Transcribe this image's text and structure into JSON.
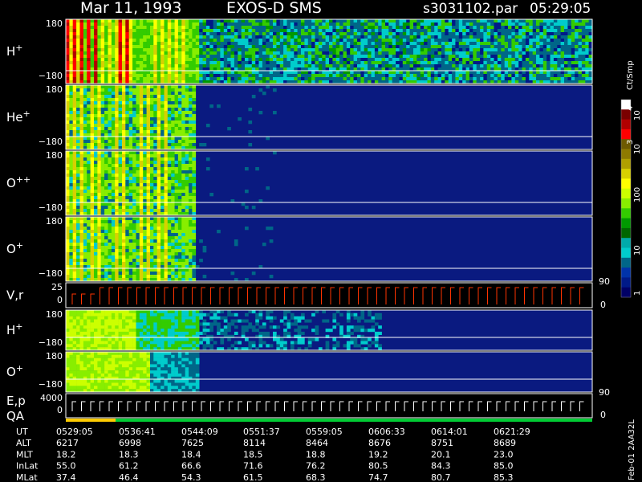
{
  "header": {
    "date": "Mar 11, 1993",
    "instrument": "EXOS-D SMS",
    "file": "s3031102.par",
    "time": "05:29:05"
  },
  "chart_data": {
    "type": "heatmap",
    "panels": [
      {
        "id": "h-plus-1",
        "label": "H",
        "sup": "+",
        "ytop": "180",
        "ybottom": "−180",
        "profile": "h1"
      },
      {
        "id": "he-plus",
        "label": "He",
        "sup": "+",
        "ytop": "180",
        "ybottom": "−180",
        "profile": "dense"
      },
      {
        "id": "o-plus-plus",
        "label": "O",
        "sup": "++",
        "ytop": "180",
        "ybottom": "−180",
        "profile": "dense"
      },
      {
        "id": "o-plus-1",
        "label": "O",
        "sup": "+",
        "ytop": "180",
        "ybottom": "−180",
        "profile": "dense"
      },
      {
        "id": "v-r",
        "label": "V,r",
        "sup": "",
        "ytop": "25",
        "ybottom": "0",
        "right": "90",
        "right_bottom": "0",
        "profile": "line"
      },
      {
        "id": "h-plus-2",
        "label": "H",
        "sup": "+",
        "ytop": "180",
        "ybottom": "−180",
        "profile": "h2"
      },
      {
        "id": "o-plus-2",
        "label": "O",
        "sup": "+",
        "ytop": "180",
        "ybottom": "−180",
        "profile": "o2"
      },
      {
        "id": "e-p-qa",
        "label": "E,p",
        "label2": "QA",
        "sup": "",
        "ytop": "4000",
        "ybottom": "0",
        "right": "90",
        "right_bottom": "0",
        "profile": "steps"
      }
    ],
    "colorbar": {
      "unit": "Ct/Smp",
      "tick_labels": [
        "10",
        "4",
        "10",
        "3",
        "100",
        "10",
        "1"
      ],
      "colors": [
        "#ffffff",
        "#7a0000",
        "#b20000",
        "#ff0000",
        "#6e5a00",
        "#8e7a00",
        "#b0a000",
        "#d8d000",
        "#ffff00",
        "#ccff00",
        "#88ee00",
        "#33cc00",
        "#009900",
        "#006600",
        "#00aaaa",
        "#00cccc",
        "#006688",
        "#0033aa",
        "#001a88",
        "#000066"
      ]
    },
    "time_axis": {
      "rows": [
        {
          "label": "UT",
          "values": [
            "0529:05",
            "0536:41",
            "0544:09",
            "0551:37",
            "0559:05",
            "0606:33",
            "0614:01",
            "0621:29"
          ]
        },
        {
          "label": "ALT",
          "values": [
            "6217",
            "6998",
            "7625",
            "8114",
            "8464",
            "8676",
            "8751",
            "8689"
          ]
        },
        {
          "label": "MLT",
          "values": [
            "18.2",
            "18.3",
            "18.4",
            "18.5",
            "18.8",
            "19.2",
            "20.1",
            "23.0"
          ]
        },
        {
          "label": "InLat",
          "values": [
            "55.0",
            "61.2",
            "66.6",
            "71.6",
            "76.2",
            "80.5",
            "84.3",
            "85.0"
          ]
        },
        {
          "label": "MLat",
          "values": [
            "37.4",
            "46.4",
            "54.3",
            "61.5",
            "68.3",
            "74.7",
            "80.7",
            "85.3"
          ]
        }
      ]
    },
    "footer_id": "Feb-01 2AA32L",
    "colors": {
      "background": "#000000",
      "field": "#0a1a80",
      "quality_bar": "#ffcc00",
      "quality_good": "#00cc33",
      "line_trace": "#ff3300"
    }
  }
}
